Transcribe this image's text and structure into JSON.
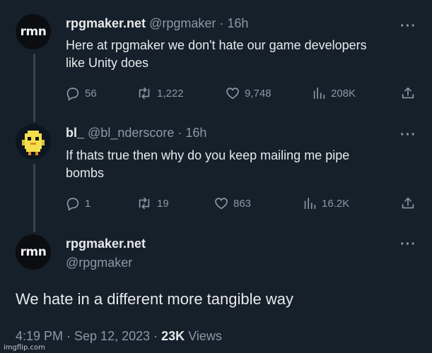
{
  "tweets": [
    {
      "name": "rpgmaker.net",
      "handle": "@rpgmaker",
      "separator": "·",
      "time": "16h",
      "avatar_text": "rmn",
      "text_lines": [
        "Here at rpgmaker we don't hate our game developers",
        "like Unity does"
      ],
      "replies": "56",
      "retweets": "1,222",
      "likes": "9,748",
      "views": "208K"
    },
    {
      "name": "bl_",
      "handle": "@bl_nderscore",
      "separator": "·",
      "time": "16h",
      "avatar_icon": "yellow-bird-pixel-icon",
      "text_lines": [
        "If thats true then why do you keep mailing me pipe",
        "bombs"
      ],
      "replies": "1",
      "retweets": "19",
      "likes": "863",
      "views": "16.2K"
    }
  ],
  "main_tweet": {
    "name": "rpgmaker.net",
    "handle": "@rpgmaker",
    "avatar_text": "rmn",
    "text": "We hate in a different more tangible way",
    "timestamp": "4:19 PM · Sep 12, 2023 ·",
    "views_count": "23K",
    "views_label": "Views"
  },
  "more_label": "···",
  "watermark": "imgflip.com",
  "colors": {
    "background": "#15202b",
    "text": "#e7e9ea",
    "muted": "#8b98a5",
    "thread_line": "#38444d"
  }
}
